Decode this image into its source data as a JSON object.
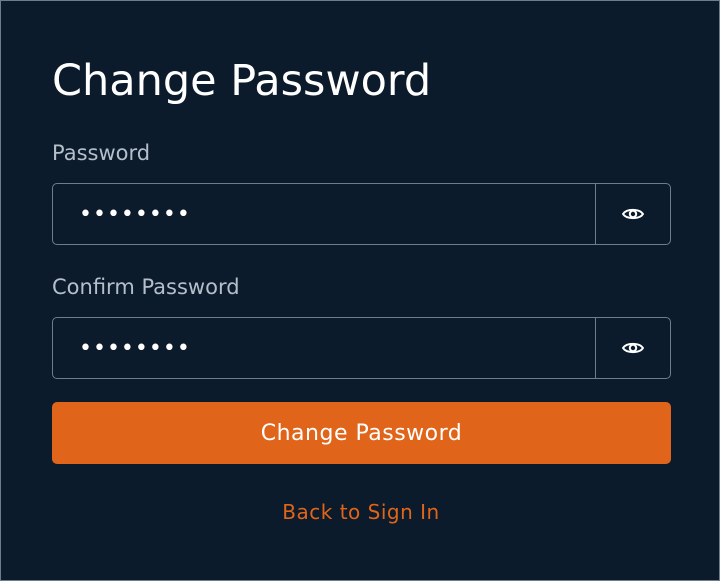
{
  "form": {
    "title": "Change Password",
    "password": {
      "label": "Password",
      "value": "••••••••",
      "toggle_icon": "eye-icon"
    },
    "confirm_password": {
      "label": "Confirm Password",
      "value": "••••••••",
      "toggle_icon": "eye-icon"
    },
    "submit_label": "Change Password",
    "back_link_label": "Back to Sign In"
  },
  "colors": {
    "background": "#0b1b2b",
    "accent": "#e06419",
    "border": "#6f7d8a",
    "label": "#b4bfca",
    "text": "#ffffff"
  }
}
